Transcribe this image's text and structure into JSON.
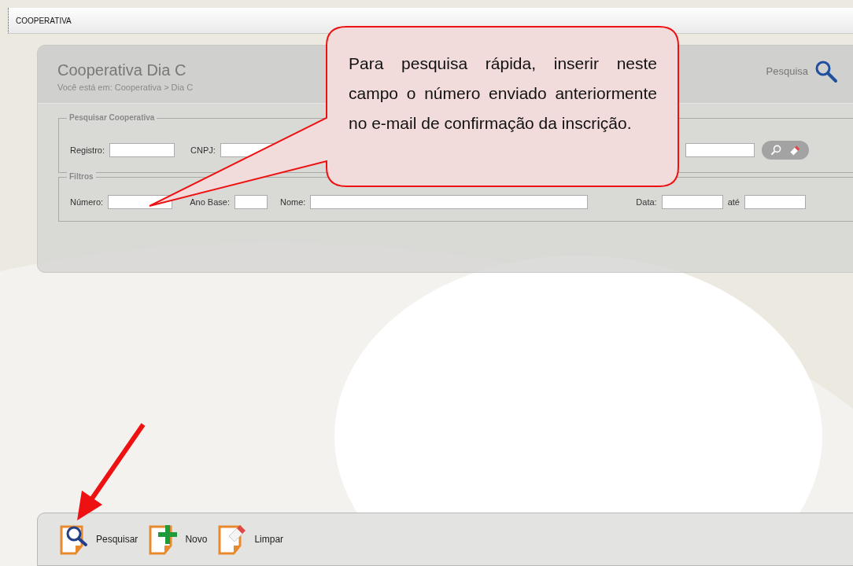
{
  "tab": {
    "title": "COOPERATIVA"
  },
  "page": {
    "title": "Cooperativa Dia C",
    "breadcrumb": "Você está em:  Cooperativa > Dia C",
    "search_link": "Pesquisa"
  },
  "search_group": {
    "legend": "Pesquisar Cooperativa",
    "fields": [
      {
        "label": "Registro:"
      },
      {
        "label": "CNPJ:"
      }
    ]
  },
  "filters": {
    "legend": "Filtros",
    "fields": [
      {
        "label": "Número:"
      },
      {
        "label": "Ano Base:"
      },
      {
        "label": "Nome:"
      },
      {
        "label": "Data:"
      },
      {
        "label": "até"
      }
    ]
  },
  "callout": {
    "text": "Para pesquisa rápida, inserir neste campo o número enviado anteriormente no e-mail de confirmação da inscrição."
  },
  "toolbar": [
    {
      "label": "Pesquisar",
      "kind": "search"
    },
    {
      "label": "Novo",
      "kind": "new"
    },
    {
      "label": "Limpar",
      "kind": "clear"
    }
  ]
}
